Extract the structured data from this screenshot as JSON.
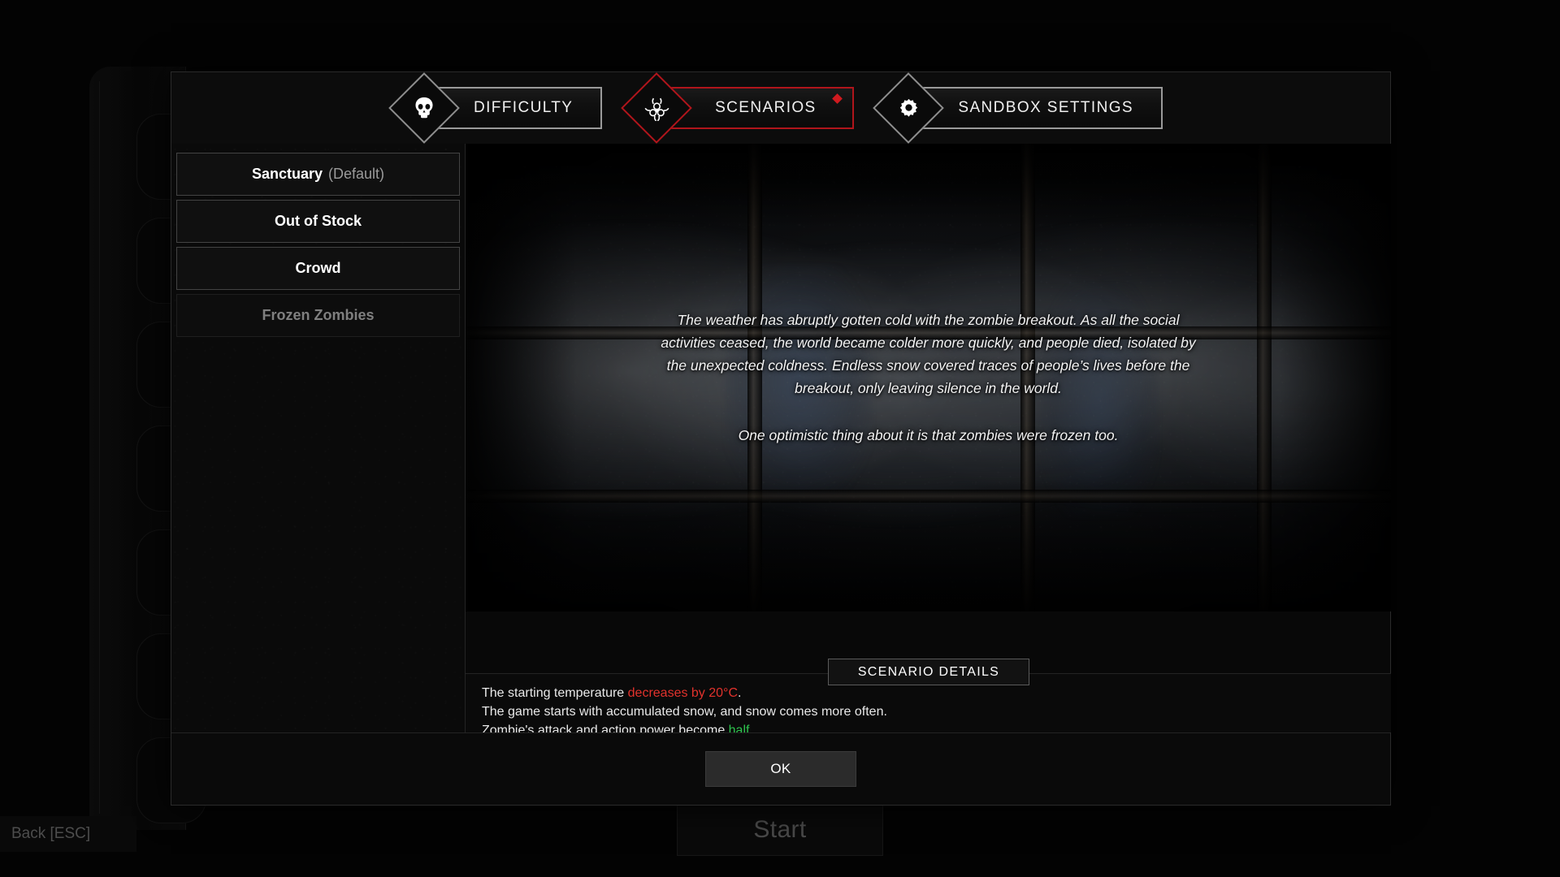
{
  "background": {
    "start_button_label": "Start",
    "back_label": "Back [ESC]"
  },
  "modal": {
    "tabs": [
      {
        "label": "DIFFICULTY",
        "icon": "skull-icon",
        "active": false
      },
      {
        "label": "SCENARIOS",
        "icon": "biohazard-icon",
        "active": true
      },
      {
        "label": "SANDBOX SETTINGS",
        "icon": "gear-icon",
        "active": false
      }
    ],
    "accent_color": "#b0151b",
    "marker_color": "#d01a1f",
    "scenario_list": [
      {
        "name": "Sanctuary",
        "suffix": "(Default)",
        "selected": false
      },
      {
        "name": "Out of Stock",
        "suffix": "",
        "selected": false
      },
      {
        "name": "Crowd",
        "suffix": "",
        "selected": false
      },
      {
        "name": "Frozen Zombies",
        "suffix": "",
        "selected": true
      }
    ],
    "description": {
      "paragraph_1": "The weather has abruptly gotten cold with the zombie breakout. As all the social activities ceased, the world became colder more quickly, and people died, isolated by the unexpected coldness. Endless snow covered traces of people’s lives before the breakout, only leaving silence in the world.",
      "paragraph_2": "One optimistic thing about it is that zombies were frozen too."
    },
    "details_badge_label": "SCENARIO DETAILS",
    "details": {
      "line_1_prefix": "The starting temperature ",
      "line_1_highlight": "decreases by 20°C",
      "line_1_suffix": ".",
      "line_2": "The game starts with accumulated snow, and snow comes more often.",
      "line_3_prefix": "Zombie's attack and action power become ",
      "line_3_highlight": "half",
      "line_3_suffix": ".",
      "highlight_red": "#e2322c",
      "highlight_green": "#2ec44e"
    },
    "ok_label": "OK"
  }
}
